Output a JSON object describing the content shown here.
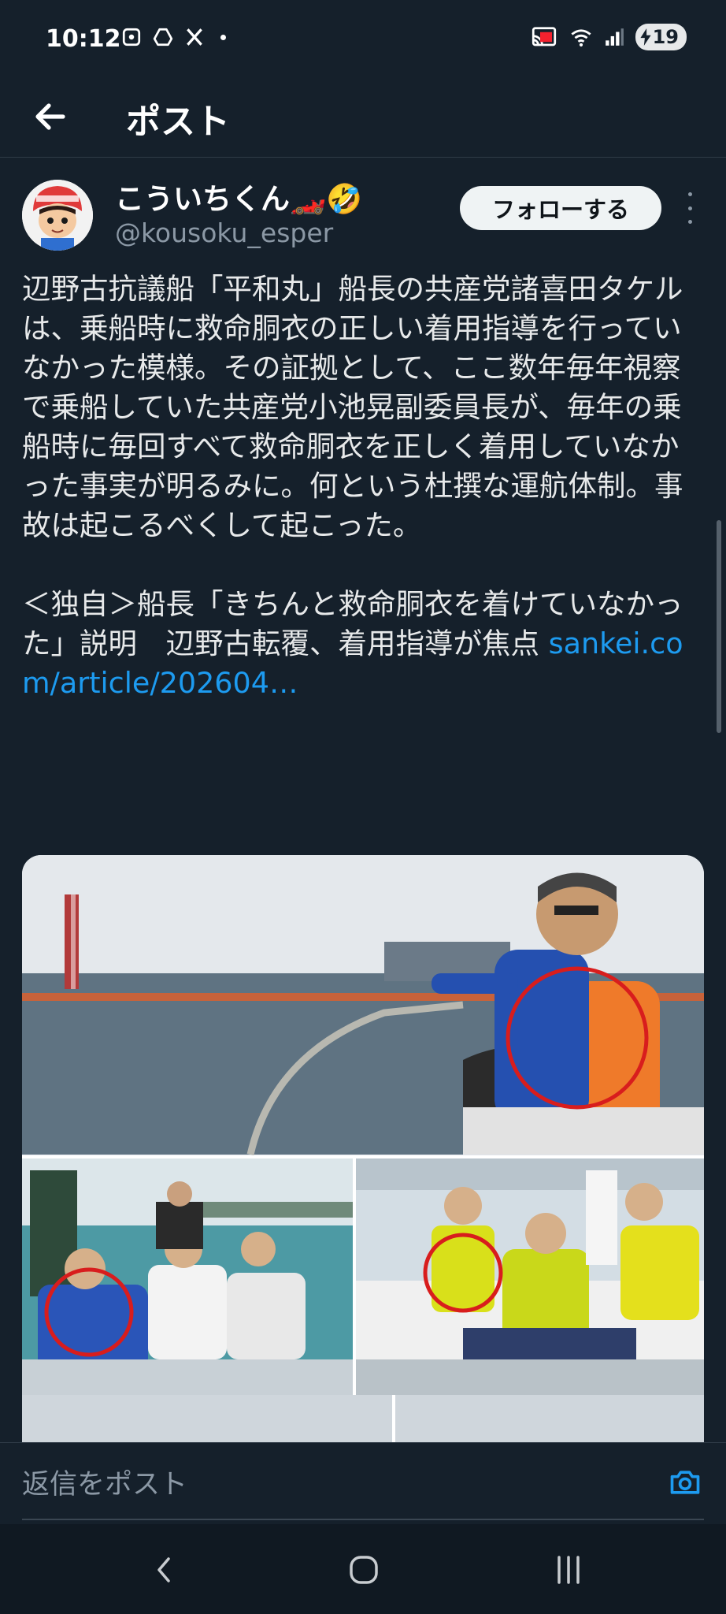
{
  "status_bar": {
    "time": "10:12",
    "battery_level": "19",
    "icons_left": [
      "photo-icon",
      "drive-icon",
      "x-logo-icon"
    ],
    "icons_right": [
      "cast-icon",
      "wifi-icon",
      "signal-icon",
      "battery-icon"
    ]
  },
  "header": {
    "title": "ポスト"
  },
  "post": {
    "author_name": "こういちくん🏎️🤣",
    "author_handle": "@kousoku_esper",
    "follow_label": "フォローする",
    "text": "辺野古抗議船「平和丸」船長の共産党諸喜田タケルは、乗船時に救命胴衣の正しい着用指導を行っていなかった模様。その証拠として、ここ数年毎年視察で乗船していた共産党小池晃副委員長が、毎年の乗船時に毎回すべて救命胴衣を正しく着用していなかった事実が明るみに。何という杜撰な運航体制。事故は起こるべくして起こった。\n\n＜独自＞船長「きちんと救命胴衣を着けていなかった」説明　辺野古転覆、着用指導が焦点 ",
    "link_text": "sankei.com/article/202604…"
  },
  "reply_bar": {
    "placeholder": "返信をポスト"
  },
  "colors": {
    "background": "#15202b",
    "link": "#1d9bf0",
    "secondary_text": "#8b98a5"
  }
}
